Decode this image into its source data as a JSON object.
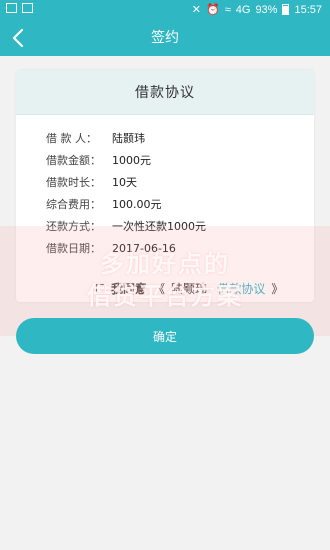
{
  "status_bar": {
    "battery_percent": "93%",
    "time": "15:57",
    "signal_text": "4G"
  },
  "header": {
    "title": "签约",
    "back_icon": "back-chevron-icon"
  },
  "card": {
    "title": "借款协议",
    "rows": [
      {
        "label": "借 款 人：",
        "value": "陆颢玮"
      },
      {
        "label": "借款金额：",
        "value": "1000元"
      },
      {
        "label": "借款时长：",
        "value": "10天"
      },
      {
        "label": "综合费用：",
        "value": "100.00元"
      },
      {
        "label": "还款方式：",
        "value": "一次性还款1000元"
      },
      {
        "label": "借款日期：",
        "value": "2017-06-16"
      }
    ]
  },
  "watermark": {
    "line1": "多加好点的",
    "line2": "借贷平台方案"
  },
  "agreement": {
    "prefix": "我同意",
    "open_quote": "《",
    "name_part": "陆颢玮-",
    "link_text": "借款协议",
    "close_quote": "》"
  },
  "confirm_label": "确定",
  "colors": {
    "primary": "#2fb7c4",
    "page_bg": "#f2f2f2",
    "card_header_bg": "#e6f2f2"
  }
}
